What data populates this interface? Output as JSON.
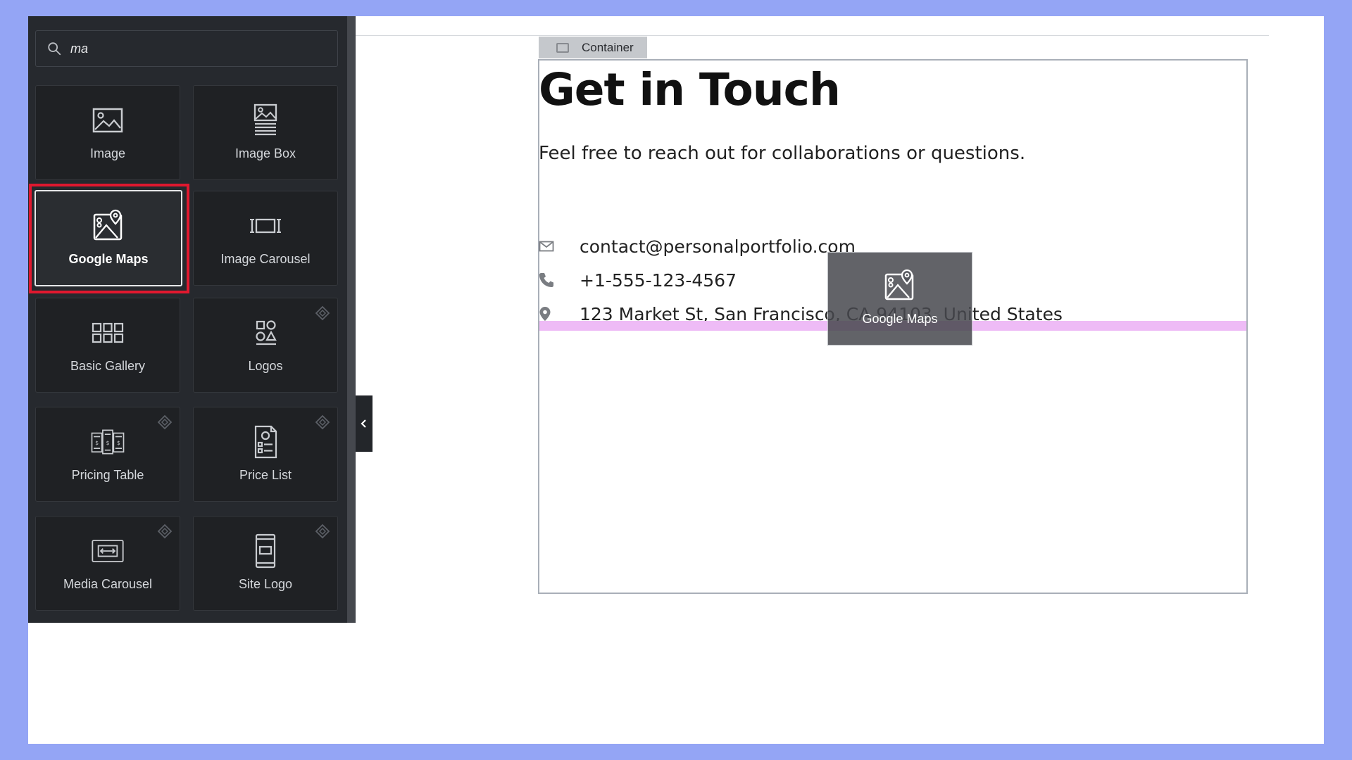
{
  "panel": {
    "search": {
      "value": "ma",
      "placeholder": ""
    },
    "widgets": [
      {
        "label": "Image",
        "icon": "image-icon",
        "pro": false,
        "selected": false
      },
      {
        "label": "Image Box",
        "icon": "image-box-icon",
        "pro": false,
        "selected": false
      },
      {
        "label": "Google Maps",
        "icon": "map-icon",
        "pro": false,
        "selected": true
      },
      {
        "label": "Image Carousel",
        "icon": "carousel-icon",
        "pro": false,
        "selected": false
      },
      {
        "label": "Basic Gallery",
        "icon": "gallery-grid-icon",
        "pro": false,
        "selected": false
      },
      {
        "label": "Logos",
        "icon": "logos-icon",
        "pro": true,
        "selected": false
      },
      {
        "label": "Pricing Table",
        "icon": "pricing-table-icon",
        "pro": true,
        "selected": false
      },
      {
        "label": "Price List",
        "icon": "price-list-icon",
        "pro": true,
        "selected": false
      },
      {
        "label": "Media Carousel",
        "icon": "media-carousel-icon",
        "pro": true,
        "selected": false
      },
      {
        "label": "Site Logo",
        "icon": "site-logo-icon",
        "pro": true,
        "selected": false
      }
    ]
  },
  "canvas": {
    "container_label": "Container",
    "heading": "Get in Touch",
    "subtext": "Feel free to reach out for collaborations or questions.",
    "contacts": [
      {
        "icon": "envelope-icon",
        "text": "contact@personalportfolio.com"
      },
      {
        "icon": "phone-icon",
        "text": "+1-555-123-4567"
      },
      {
        "icon": "map-pin-icon",
        "text": "123 Market St, San Francisco, CA 94103, United States"
      }
    ],
    "drag_ghost_label": "Google Maps"
  },
  "colors": {
    "frame": "#94a5f5",
    "panel_bg": "#26292e",
    "tile_bg": "#1f2124",
    "selection_outline": "#e0182f",
    "drop_indicator": "#eebbf6"
  }
}
